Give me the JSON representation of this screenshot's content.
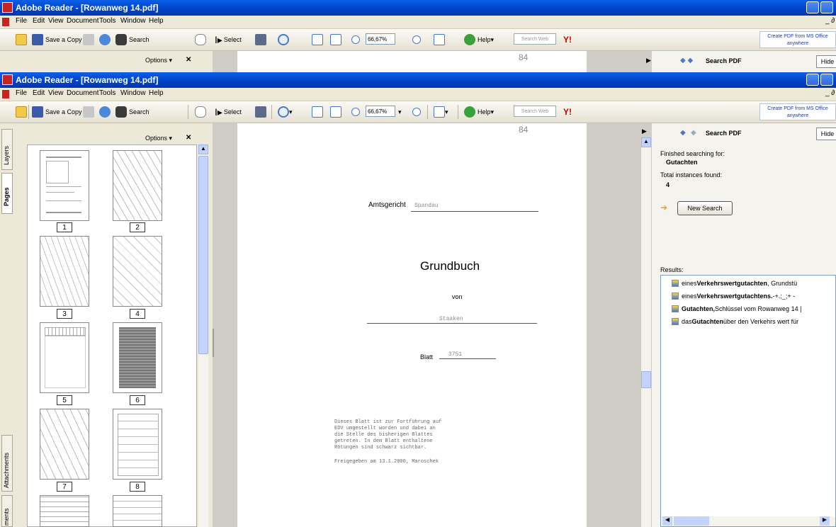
{
  "window": {
    "title": "Adobe Reader - [Rowanweg 14.pdf]"
  },
  "menu": [
    "File",
    "Edit",
    "View",
    "Document",
    "Tools",
    "Window",
    "Help"
  ],
  "toolbar": {
    "save_copy_label": "Save a Copy",
    "search_label": "Search",
    "select_label": "Select",
    "zoom_value": "66,67%",
    "help_label": "Help",
    "search_web_placeholder": "Search Web",
    "create_pdf_line1": "Create PDF from MS Office",
    "create_pdf_line2": "anywhere"
  },
  "back_window": {
    "options_label": "Options ▾",
    "close_label": "✕",
    "search_pdf_label": "Search PDF",
    "hide_label": "Hide",
    "page_number_mark": "84"
  },
  "nav_panel": {
    "options_label": "Options ▾",
    "close_label": "✕",
    "tabs": [
      "Layers",
      "Pages",
      "Attachments",
      "ments"
    ],
    "thumbnails": [
      "1",
      "2",
      "3",
      "4",
      "5",
      "6",
      "7",
      "8"
    ]
  },
  "document": {
    "page_number_mark": "84",
    "court_label": "Amtsgericht",
    "court_value": "Spandau",
    "title": "Grundbuch",
    "von": "von",
    "district_value": "Staaken",
    "sheet_label": "Blatt",
    "sheet_value": "3751",
    "note_lines": [
      "Dieses Blatt ist zur Fortführung auf",
      "EDV umgestellt worden und dabei an",
      "die Stelle des bisherigen Blattes",
      "getreten. In dem Blatt enthaltene",
      "Rötungen sind schwarz sichtbar."
    ],
    "release_line": "Freigegeben am 13.1.2000, Maroschek"
  },
  "search_panel": {
    "title": "Search PDF",
    "hide_label": "Hide",
    "finished_label": "Finished searching for:",
    "term": "Gutachten",
    "total_label": "Total instances found:",
    "total_value": "4",
    "new_search_label": "New Search",
    "results_label": "Results:",
    "results": [
      {
        "pre": "eines ",
        "bold": "Verkehrswertgutachten",
        "post": " , Grundstü"
      },
      {
        "pre": "eines ",
        "bold": "Verkehrswertgutachtens.",
        "post": " -+.;_;+ -"
      },
      {
        "pre": "",
        "bold": "Gutachten,",
        "post": " Schlüssel vom Rowanweg 14 |"
      },
      {
        "pre": "das ",
        "bold": "Gutachten",
        "post": " über den Verkehrs wert für"
      }
    ]
  },
  "colors": {
    "title_bar": "#0042c8",
    "doc_background": "#cfcdc6",
    "link_blue": "#1a3cb8"
  }
}
